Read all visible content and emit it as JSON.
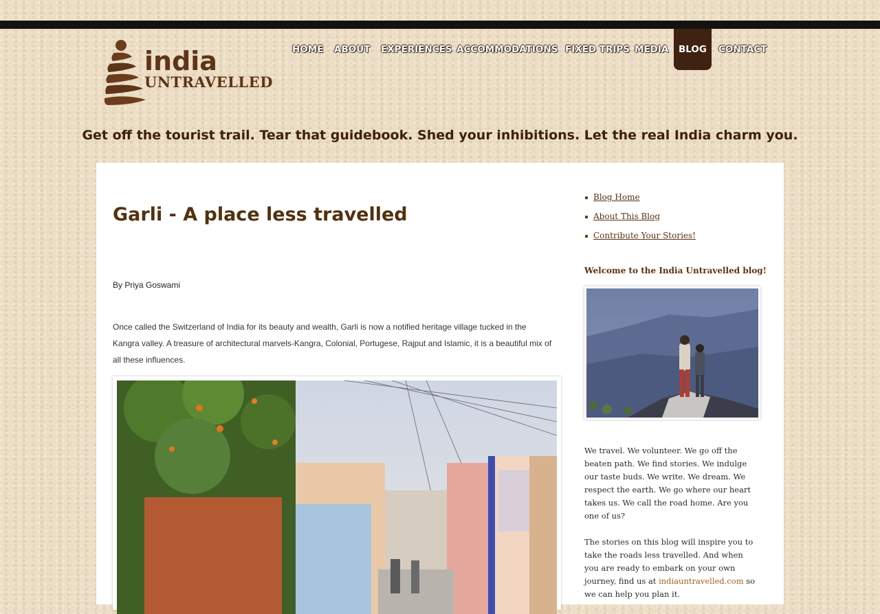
{
  "brand": {
    "logo_line1": "india",
    "logo_line2": "UNTRAVELLED",
    "tagline": "Get off the tourist trail. Tear that guidebook. Shed your inhibitions. Let the real India charm you."
  },
  "nav": {
    "items": [
      {
        "label": "HOME"
      },
      {
        "label": "ABOUT"
      },
      {
        "label": "EXPERIENCES"
      },
      {
        "label": "ACCOMMODATIONS"
      },
      {
        "label": "FIXED TRIPS"
      },
      {
        "label": "MEDIA"
      },
      {
        "label": "BLOG",
        "active": true
      },
      {
        "label": "CONTACT"
      }
    ]
  },
  "post": {
    "title": "Garli - A place less travelled",
    "byline": "By Priya Goswami",
    "paragraph": "Once called the Switzerland of India for its beauty and wealth, Garli is now a notified heritage village tucked in the Kangra valley. A treasure of architectural marvels-Kangra, Colonial, Portugese, Rajput and Islamic, it is a beautiful mix of all these influences."
  },
  "sidebar": {
    "links": [
      {
        "label": "Blog Home"
      },
      {
        "label": "About This Blog"
      },
      {
        "label": "Contribute Your Stories!"
      }
    ],
    "welcome_heading": "Welcome to the India Untravelled blog!",
    "intro_text": "We travel. We volunteer. We go off the beaten path. We find stories. We indulge our taste buds. We write. We dream. We respect the earth. We go where our heart takes us. We call the road home. Are you one of us?",
    "stories_text_before": "The stories on this blog will inspire you to take the roads less travelled. And when you are ready to embark on your own journey, find us at",
    "stories_link": "indiauntravelled.com",
    "stories_text_after": "so we can help you plan it."
  },
  "colors": {
    "background": "#ebdcc2",
    "top_bar": "#141210",
    "nav_active": "#3f2211",
    "heading_brown": "#52310e",
    "link_orange": "#a6601d"
  }
}
